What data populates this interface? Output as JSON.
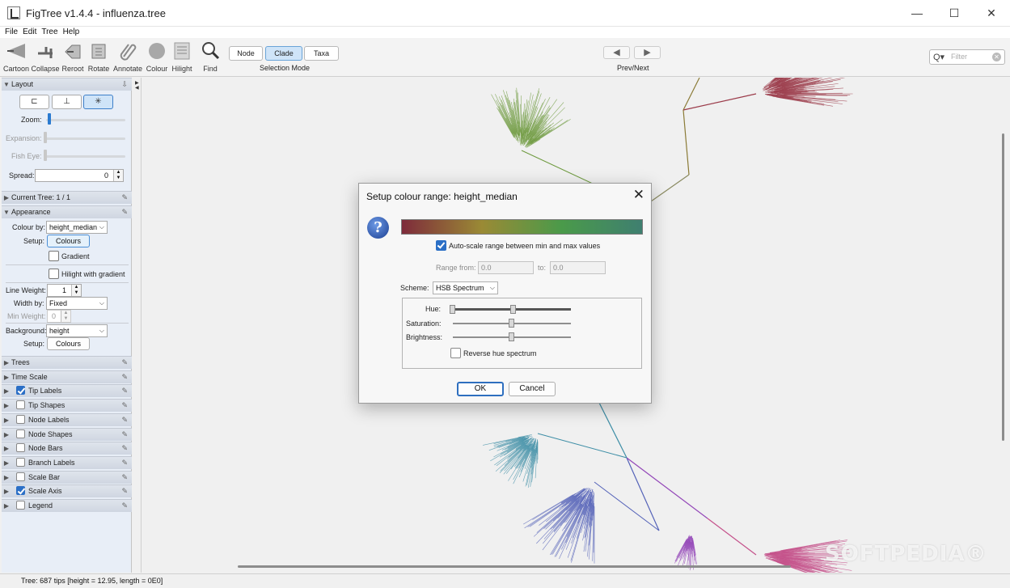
{
  "window": {
    "title": "FigTree v1.4.4 - influenza.tree",
    "min_glyph": "—",
    "max_glyph": "☐",
    "close_glyph": "✕"
  },
  "menu": [
    "File",
    "Edit",
    "Tree",
    "Help"
  ],
  "toolbar": {
    "tools": [
      "Cartoon",
      "Collapse",
      "Reroot",
      "Rotate",
      "Annotate",
      "Colour",
      "Hilight",
      "Find"
    ],
    "selection_modes": [
      "Node",
      "Clade",
      "Taxa"
    ],
    "selection_active": "Clade",
    "selection_caption": "Selection Mode",
    "prev_glyph": "◀",
    "next_glyph": "▶",
    "prevnext_caption": "Prev/Next",
    "filter_placeholder": "Filter",
    "filter_glyph": "Q▾",
    "filter_clear": "✕"
  },
  "panel": {
    "layout": {
      "header": "Layout",
      "buttons": [
        "⊏",
        "⊥",
        "✳"
      ],
      "zoom_label": "Zoom:",
      "zoom_value": 0.02,
      "expansion_label": "Expansion:",
      "fisheye_label": "Fish Eye:",
      "spread_label": "Spread:",
      "spread_value": "0"
    },
    "current_tree": "Current Tree: 1 / 1",
    "appearance": {
      "header": "Appearance",
      "colour_by_label": "Colour by:",
      "colour_by_value": "height_median",
      "setup_label": "Setup:",
      "colours_button": "Colours",
      "gradient_label": "Gradient",
      "hilight_gradient_label": "Hilight with gradient",
      "line_weight_label": "Line Weight:",
      "line_weight_value": "1",
      "width_by_label": "Width by:",
      "width_by_value": "Fixed",
      "min_weight_label": "Min Weight:",
      "min_weight_value": "0",
      "background_label": "Background:",
      "background_value": "height",
      "setup2_label": "Setup:",
      "colours2_button": "Colours"
    },
    "sections": [
      {
        "label": "Trees",
        "has_check": false,
        "checked": false
      },
      {
        "label": "Time Scale",
        "has_check": false,
        "checked": false
      },
      {
        "label": "Tip Labels",
        "has_check": true,
        "checked": true
      },
      {
        "label": "Tip Shapes",
        "has_check": true,
        "checked": false
      },
      {
        "label": "Node Labels",
        "has_check": true,
        "checked": false
      },
      {
        "label": "Node Shapes",
        "has_check": true,
        "checked": false
      },
      {
        "label": "Node Bars",
        "has_check": true,
        "checked": false
      },
      {
        "label": "Branch Labels",
        "has_check": true,
        "checked": false
      },
      {
        "label": "Scale Bar",
        "has_check": true,
        "checked": false
      },
      {
        "label": "Scale Axis",
        "has_check": true,
        "checked": true
      },
      {
        "label": "Legend",
        "has_check": true,
        "checked": false
      }
    ]
  },
  "dialog": {
    "title": "Setup colour range: height_median",
    "close_glyph": "✕",
    "question_glyph": "?",
    "gradient_colors": [
      "#7e2b3b",
      "#9a8a35",
      "#4a9a4a",
      "#3f7f70"
    ],
    "autoscale_label": "Auto-scale range between min and max values",
    "autoscale_checked": true,
    "range_from_label": "Range from:",
    "range_from_value": "0.0",
    "range_to_label": "to:",
    "range_to_value": "0.0",
    "scheme_label": "Scheme:",
    "scheme_value": "HSB Spectrum",
    "hue_label": "Hue:",
    "saturation_label": "Saturation:",
    "brightness_label": "Brightness:",
    "reverse_label": "Reverse hue spectrum",
    "reverse_checked": false,
    "ok_label": "OK",
    "cancel_label": "Cancel"
  },
  "status": "Tree: 687 tips [height = 12.95, length = 0E0]",
  "watermark": "SOFTPEDIA®",
  "tree_colors": {
    "olive": "#8a7a35",
    "maroon": "#9b3b4a",
    "green": "#6e9a3f",
    "teal": "#3e8ea6",
    "blue": "#5462b8",
    "purple": "#9346b8",
    "pink": "#c4508a"
  }
}
